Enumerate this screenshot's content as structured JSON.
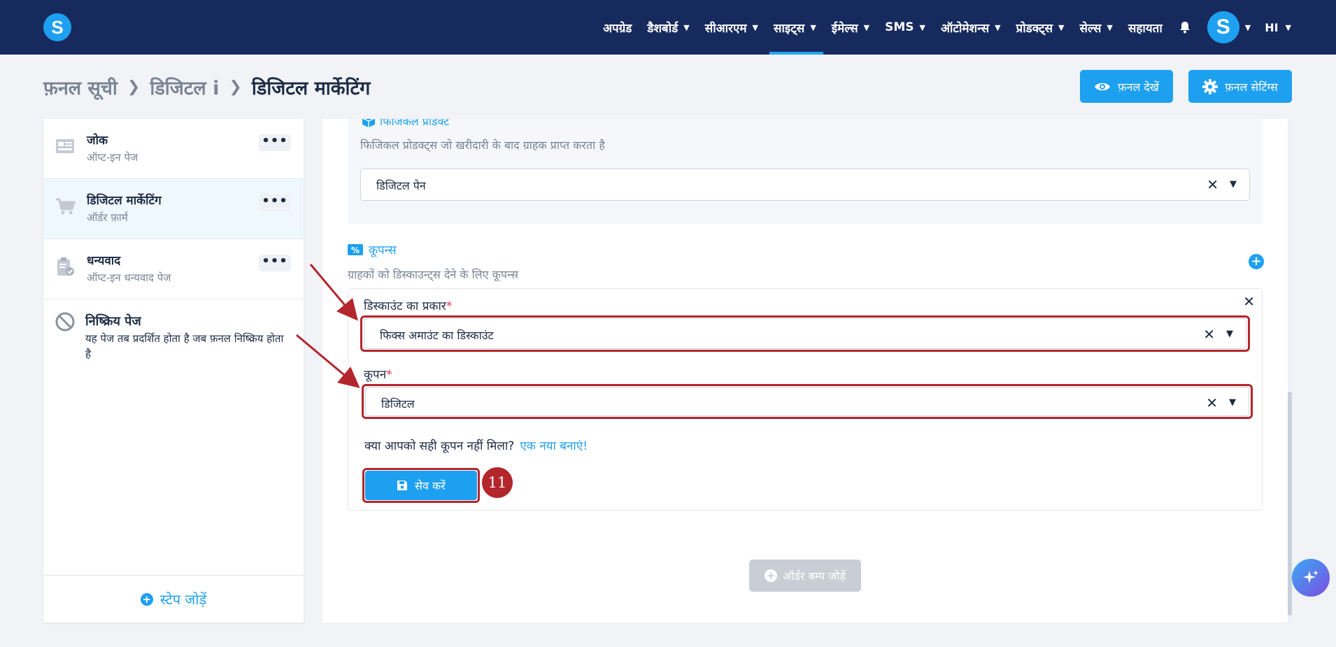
{
  "nav": {
    "logo": "S",
    "items": [
      {
        "label": "अपग्रेड",
        "chevron": false,
        "active": false
      },
      {
        "label": "डैशबोर्ड",
        "chevron": true,
        "active": false
      },
      {
        "label": "सीआरएम",
        "chevron": true,
        "active": false
      },
      {
        "label": "साइट्स",
        "chevron": true,
        "active": true
      },
      {
        "label": "ईमेल्स",
        "chevron": true,
        "active": false
      },
      {
        "label": "SMS",
        "chevron": true,
        "active": false
      },
      {
        "label": "ऑटोमेशन्स",
        "chevron": true,
        "active": false
      },
      {
        "label": "प्रोडक्ट्स",
        "chevron": true,
        "active": false
      },
      {
        "label": "सेल्स",
        "chevron": true,
        "active": false
      },
      {
        "label": "सहायता",
        "chevron": false,
        "active": false
      }
    ],
    "avatar": "S",
    "language": "HI"
  },
  "breadcrumb": {
    "root": "फ़नल सूची",
    "middle": "डिजिटल i",
    "current": "डिजिटल मार्केटिंग"
  },
  "header_buttons": {
    "view_funnel": "फ़नल देखें",
    "funnel_settings": "फ़नल सेटिंग्स"
  },
  "sidebar": {
    "steps": [
      {
        "title": "जोक",
        "subtitle": "ऑप्ट-इन पेज",
        "icon": "optin-page-icon",
        "selected": false
      },
      {
        "title": "डिजिटल मार्केटिंग",
        "subtitle": "ऑर्डर फ़ार्म",
        "icon": "cart-icon",
        "selected": true
      },
      {
        "title": "धन्यवाद",
        "subtitle": "ऑप्ट-इन धन्यवाद पेज",
        "icon": "clipboard-check-icon",
        "selected": false
      }
    ],
    "inactive_title": "निष्क्रिय पेज",
    "inactive_desc": "यह पेज तब प्रदर्शित होता है जब फ़नल निष्क्रिय होता है",
    "add_step": "स्टेप जोड़ें"
  },
  "main": {
    "physical_title": "फिजिकल प्रोडक्ट",
    "physical_desc": "फिजिकल प्रोडक्ट्स जो खरीदारी के बाद ग्राहक प्राप्त करता है",
    "physical_value": "डिजिटल पेन",
    "coupons_title": "कूपन्स",
    "coupons_desc": "ग्राहकों को डिस्काउन्ट्स देने के लिए कूपन्स",
    "discount_label": "डिस्काउंट का प्रकार",
    "discount_value": "फिक्स अमाउंट का डिस्काउंट",
    "coupon_label": "कूपन",
    "coupon_value": "डिजिटल",
    "required_mark": "*",
    "not_found_text": "क्या आपको सही कूपन नहीं मिला?",
    "create_new_link": "एक नया बनाएं!",
    "save_label": "सेव करें",
    "step_badge": "11",
    "order_bump_label": "ऑर्डर बम्प जोड़ें"
  },
  "colors": {
    "nav_bg": "#172a5e",
    "accent": "#1ea0f0",
    "annotation_red": "#b3262c"
  }
}
